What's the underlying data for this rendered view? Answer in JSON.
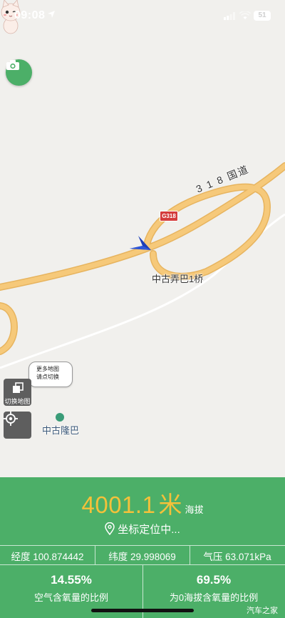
{
  "status_bar": {
    "time": "09:08",
    "battery": "51"
  },
  "map": {
    "road_name": "3 1 8 国道",
    "highway_shield": "G318",
    "bridge_label": "中古弄巴1桥",
    "village_label": "中古隆巴",
    "bubble_line1": "更多地图",
    "bubble_line2": "请点切换",
    "switch_map_label": "切换地图"
  },
  "panel": {
    "altitude_value": "4001.1",
    "altitude_unit": "米",
    "altitude_label": "海拔",
    "locating_text": "坐标定位中...",
    "longitude": "经度 100.874442",
    "latitude": "纬度 29.998069",
    "pressure": "气压 63.071kPa",
    "oxygen_ratio_value": "14.55%",
    "oxygen_ratio_label": "空气含氧量的比例",
    "oxygen_sea_value": "69.5%",
    "oxygen_sea_label": "为0海拔含氧量的比例"
  },
  "watermark": "汽车之家",
  "colors": {
    "panel": "#4caf68",
    "altitude": "#f4c13a",
    "road": "#f6c97a"
  }
}
